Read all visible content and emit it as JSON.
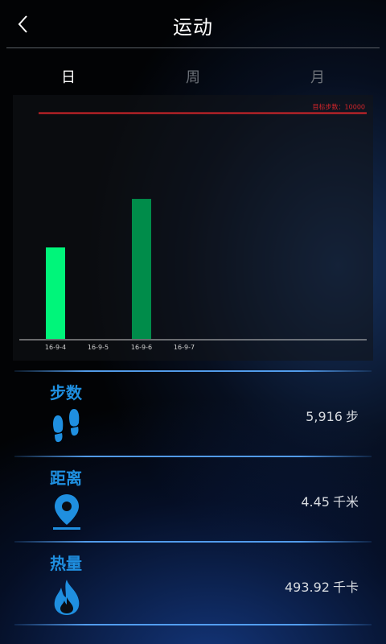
{
  "header": {
    "title": "运动"
  },
  "tabs": [
    {
      "label": "日",
      "active": true
    },
    {
      "label": "周",
      "active": false
    },
    {
      "label": "月",
      "active": false
    }
  ],
  "chart_data": {
    "type": "bar",
    "categories": [
      "16-9-4",
      "16-9-5",
      "16-9-6",
      "16-9-7"
    ],
    "values": [
      4050,
      0,
      6200,
      0
    ],
    "goal_label": "目标步数：10000",
    "goal_value": 10000,
    "ylim": [
      0,
      10800
    ],
    "bar_colors": [
      "#00f57a",
      "#00f57a",
      "#008c4a",
      "#008c4a"
    ],
    "goal_color": "#d6252a"
  },
  "stats": {
    "steps": {
      "label": "步数",
      "value": "5,916",
      "unit": "步",
      "icon": "footprints-icon"
    },
    "distance": {
      "label": "距离",
      "value": "4.45",
      "unit": "千米",
      "icon": "location-pin-icon"
    },
    "calories": {
      "label": "热量",
      "value": "493.92",
      "unit": "千卡",
      "icon": "flame-icon"
    }
  },
  "colors": {
    "accent": "#1f8fe0",
    "divider": "#5aaaff"
  }
}
